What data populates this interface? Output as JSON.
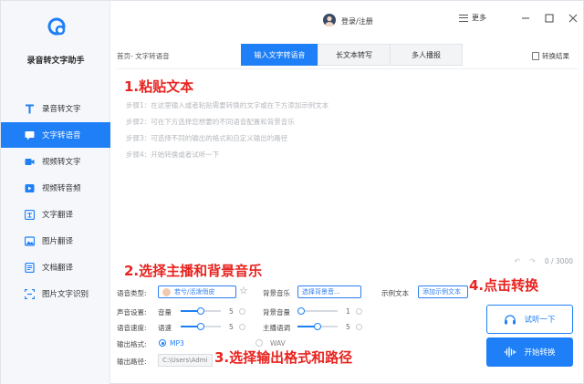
{
  "app": {
    "name": "录音转文字助手"
  },
  "topbar": {
    "login": "登录/注册",
    "more": "更多"
  },
  "sidebar": {
    "items": [
      {
        "label": "录音转文字",
        "icon": "t-letter-icon",
        "active": false
      },
      {
        "label": "文字转语音",
        "icon": "chat-icon",
        "active": true
      },
      {
        "label": "视频转文字",
        "icon": "video-icon",
        "active": false
      },
      {
        "label": "视频转音频",
        "icon": "video-audio-icon",
        "active": false
      },
      {
        "label": "文字翻译",
        "icon": "translate-icon",
        "active": false
      },
      {
        "label": "图片翻译",
        "icon": "image-icon",
        "active": false
      },
      {
        "label": "文档翻译",
        "icon": "document-icon",
        "active": false
      },
      {
        "label": "图片文字识别",
        "icon": "ocr-icon",
        "active": false
      }
    ]
  },
  "breadcrumb": "首页- 文字转语音",
  "tabs": [
    {
      "label": "输入文字转语音",
      "active": true
    },
    {
      "label": "长文本转写",
      "active": false
    },
    {
      "label": "多人播报",
      "active": false
    }
  ],
  "convert_result": "转换结果",
  "annotations": {
    "a1": "1.粘贴文本",
    "a2": "2.选择主播和背景音乐",
    "a3": "3.选择输出格式和路径",
    "a4": "4.点击转换"
  },
  "steps": [
    "步骤1：在这里输入或者粘贴需要转换的文字或在下方添加示例文本",
    "步骤2：可在下方选择您想要的不同语音配置和背景音乐",
    "步骤3：可选择不同的输出的格式和自定义输出的路径",
    "步骤4：开始转换或者试听一下"
  ],
  "counter": "0 / 3000",
  "settings": {
    "voice_type_label": "语音类型:",
    "voice_value": "若兮/活泼俏皮",
    "bgm_label": "背景音乐",
    "bgm_value": "选择背景音...",
    "sample_label": "示例文本",
    "sample_value": "添加示例文本",
    "sound_label": "声音设置:",
    "volume_label": "音量",
    "volume_value": "5",
    "volume_fill": 0.5,
    "bg_volume_label": "背景音量",
    "bg_volume_value": "1",
    "bg_volume_fill": 0.1,
    "speed_section_label": "语音速度:",
    "speed_label": "语速",
    "speed_value": "5",
    "speed_fill": 0.5,
    "pitch_label": "主播语调",
    "pitch_value": "5",
    "pitch_fill": 0.5,
    "format_label": "输出格式:",
    "format_mp3": "MP3",
    "format_wav": "WAV",
    "path_label": "输出路径:",
    "path_value": "C:\\Users\\Admi"
  },
  "buttons": {
    "try": "试听一下",
    "start": "开始转换"
  },
  "colors": {
    "accent": "#1e7ff6",
    "annotation": "#e8231f"
  }
}
